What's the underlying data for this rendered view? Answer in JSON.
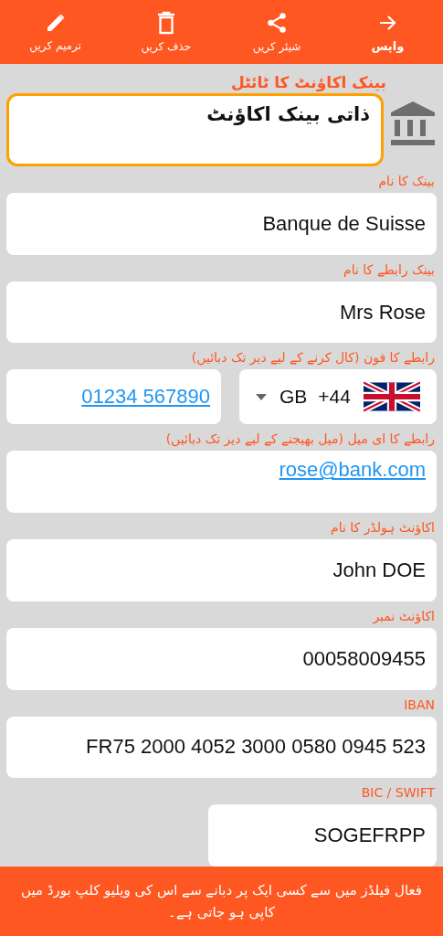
{
  "toolbar": [
    {
      "kind": "back",
      "label": "واپس"
    },
    {
      "kind": "share",
      "label": "شیئر کریں"
    },
    {
      "kind": "delete",
      "label": "حذف کریں"
    },
    {
      "kind": "edit",
      "label": "ترمیم کریں"
    }
  ],
  "title_field": {
    "label": "بینک اکاؤنٹ کا ٹائٹل",
    "value": "ذاتی بینک اکاؤنٹ",
    "focused": true
  },
  "fields": [
    {
      "kind": "text",
      "label": "بینک کا نام",
      "value": "Banque de Suisse"
    },
    {
      "kind": "text",
      "label": "بینک رابطے کا نام",
      "value": "Mrs Rose"
    },
    {
      "kind": "phone",
      "label": "رابطے کا فون (کال کرنے کے لیے دیر تک دبائیں)",
      "country": "GB",
      "dial_code": "+44",
      "value": "01234 567890"
    },
    {
      "kind": "email",
      "label": "رابطے کا ای میل (میل بھیجنے کے لیے دیر تک دبائیں)",
      "value": "rose@bank.com"
    },
    {
      "kind": "text",
      "label": "اکاؤنٹ ہولڈر کا نام",
      "value": "John DOE"
    },
    {
      "kind": "text",
      "label": "اکاؤنٹ نمبر",
      "value": "00058009455"
    },
    {
      "kind": "text",
      "label": "IBAN",
      "value": "FR75 2000 4052 3000 0580 0945 523"
    },
    {
      "kind": "short",
      "label": "BIC / SWIFT",
      "value": "SOGEFRPP"
    }
  ],
  "footer": {
    "text": "فعال فیلڈز میں سے کسی ایک پر دبانے سے اس کی ویلیو کلپ بورڈ میں کاپی ہو جاتی ہے۔"
  }
}
